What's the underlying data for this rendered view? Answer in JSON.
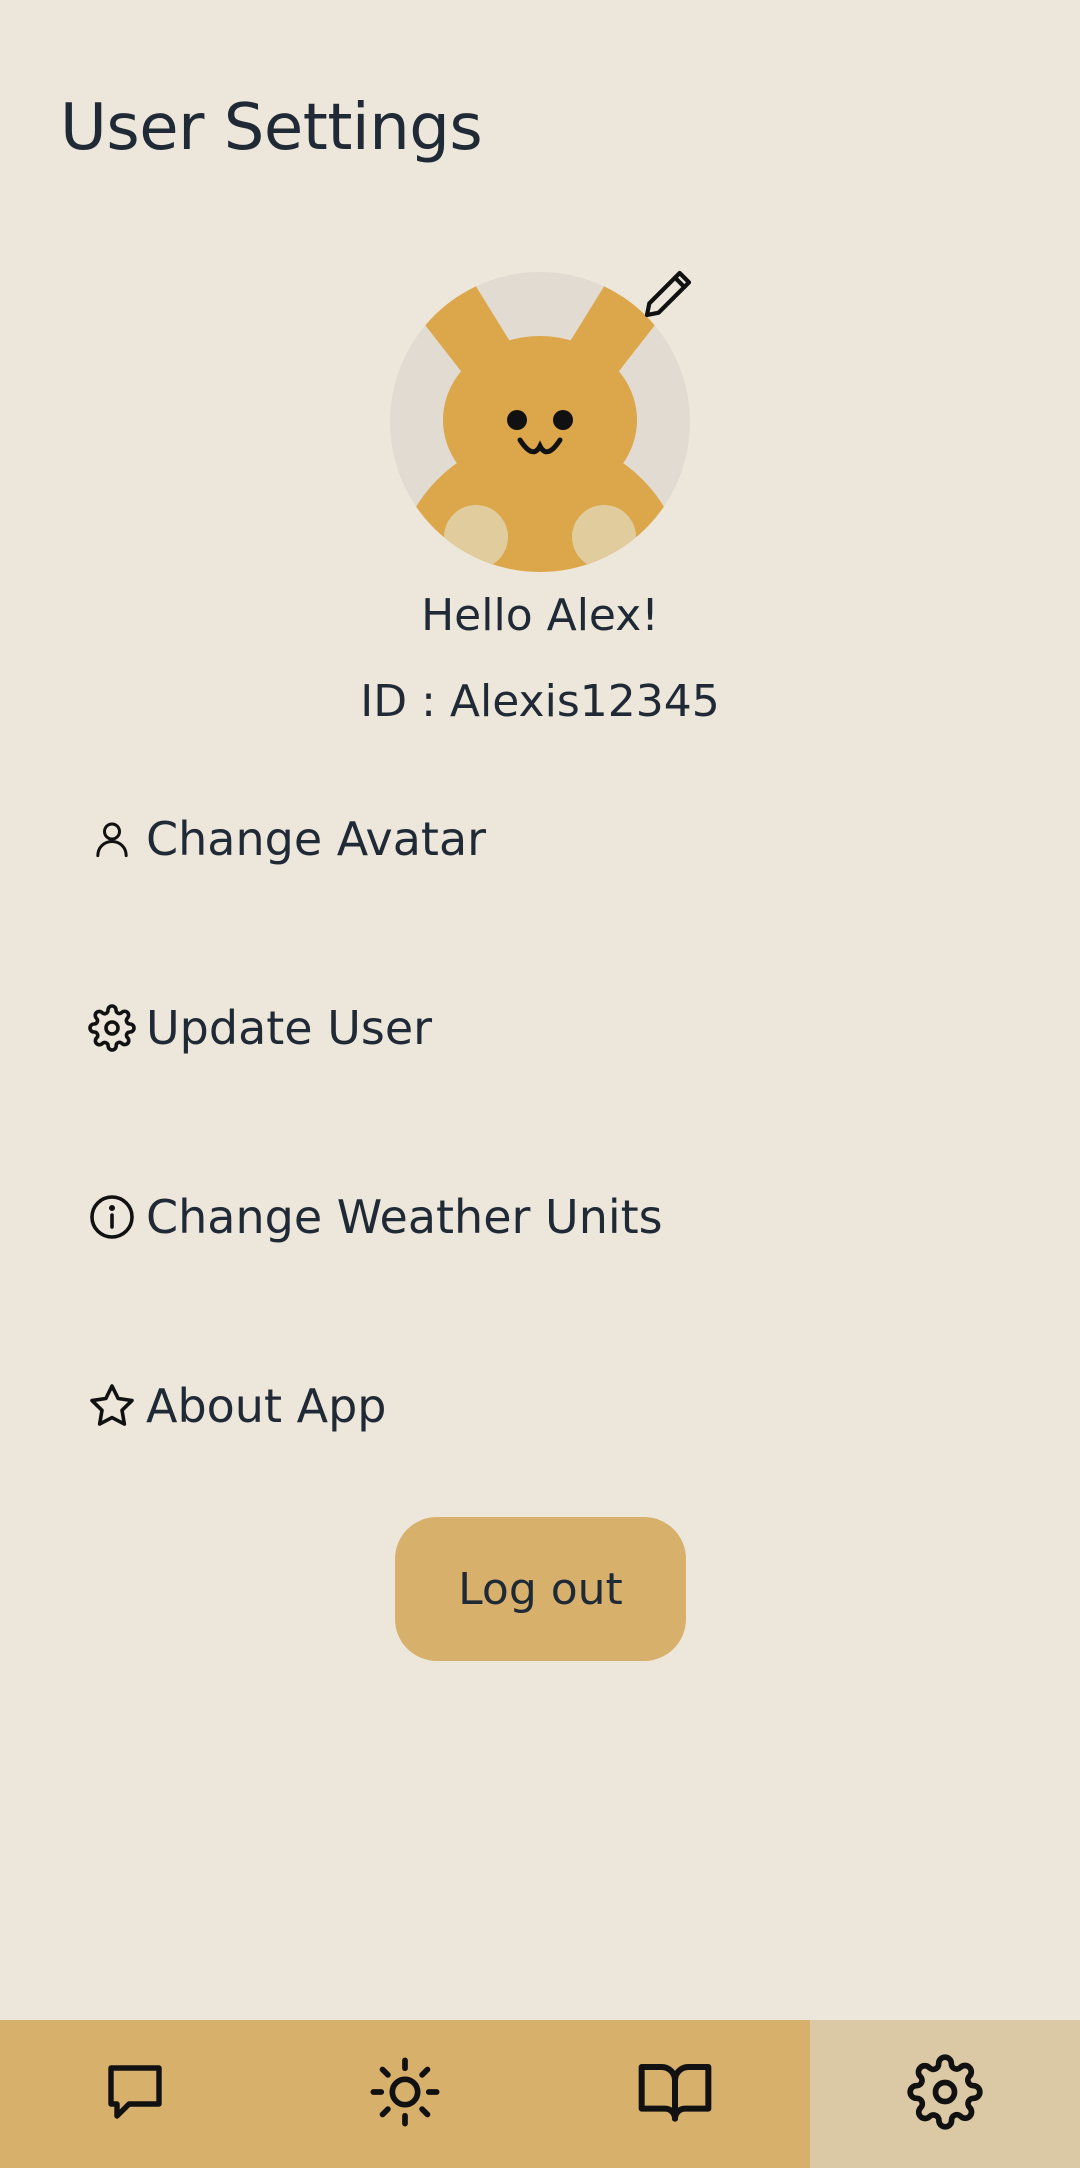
{
  "header": {
    "title": "User Settings"
  },
  "profile": {
    "greeting": "Hello Alex!",
    "id_text": "ID : Alexis12345",
    "avatar_icon": "bunny-avatar",
    "edit_icon": "pencil-icon"
  },
  "menu": {
    "items": [
      {
        "label": "Change Avatar",
        "icon": "user-icon"
      },
      {
        "label": "Update User",
        "icon": "gear-icon"
      },
      {
        "label": "Change Weather Units",
        "icon": "info-icon"
      },
      {
        "label": "About App",
        "icon": "star-icon"
      }
    ]
  },
  "logout": {
    "label": "Log out"
  },
  "bottom_nav": {
    "items": [
      {
        "icon": "chat-icon",
        "active": false
      },
      {
        "icon": "sun-icon",
        "active": false
      },
      {
        "icon": "book-icon",
        "active": false
      },
      {
        "icon": "settings-gear-icon",
        "active": true
      }
    ]
  },
  "colors": {
    "background": "#ede6da",
    "accent": "#d7b06c",
    "nav_active": "#dbc8a5",
    "avatar_circle": "#e2dbd1",
    "avatar_body": "#dba74a",
    "avatar_paws": "#e0cc9c",
    "text": "#1f2a36"
  }
}
